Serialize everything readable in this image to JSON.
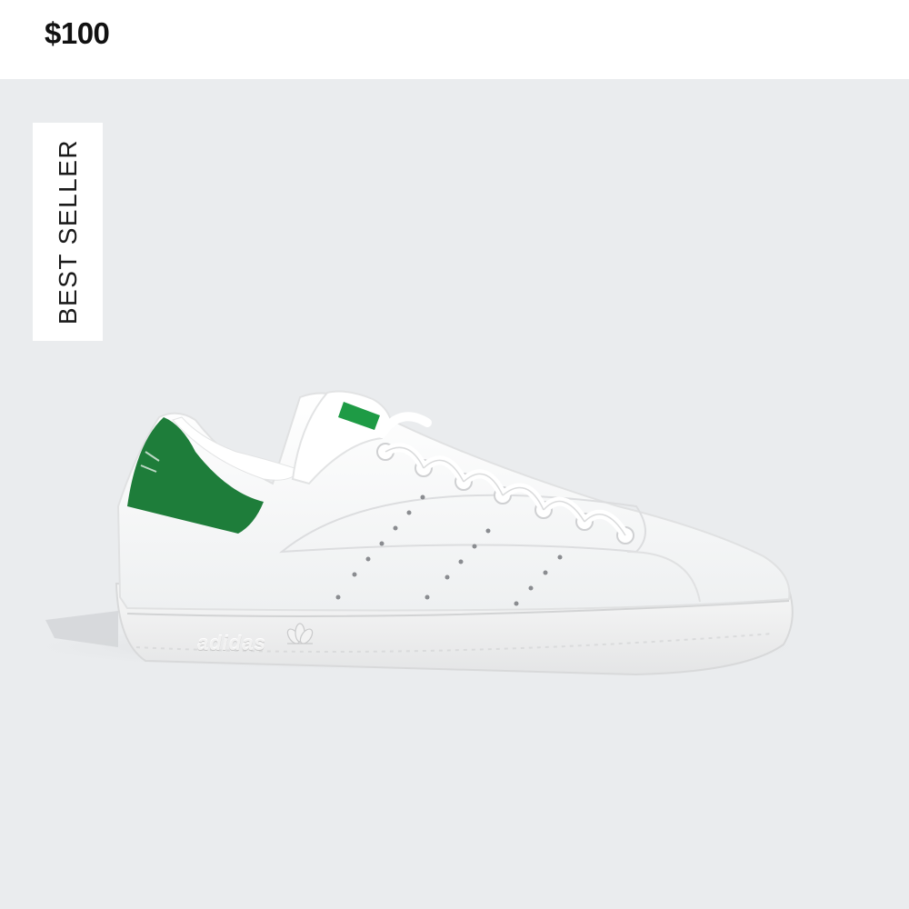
{
  "product": {
    "price": "$100",
    "badge": "BEST SELLER",
    "sole_logo": "adidas"
  },
  "colors": {
    "image_background": "#eaecee",
    "shoe_white": "#ffffff",
    "heel_tab_green": "#1e7d3a"
  },
  "icons": {
    "trefoil": "trefoil-logo-icon"
  }
}
